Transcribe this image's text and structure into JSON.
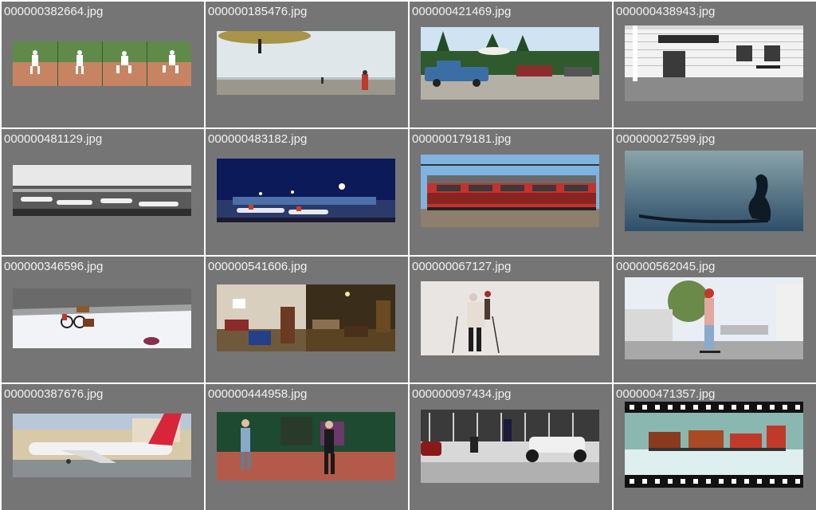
{
  "viewer": {
    "tiles": [
      {
        "filename": "000000382664.jpg",
        "icon": "baseball-pitcher-sequence-image"
      },
      {
        "filename": "000000185476.jpg",
        "icon": "beach-kite-image"
      },
      {
        "filename": "000000421469.jpg",
        "icon": "parked-trucks-image"
      },
      {
        "filename": "000000438943.jpg",
        "icon": "library-building-image"
      },
      {
        "filename": "000000481129.jpg",
        "icon": "airport-planes-bw-image"
      },
      {
        "filename": "000000483182.jpg",
        "icon": "airport-night-image"
      },
      {
        "filename": "000000179181.jpg",
        "icon": "red-train-image"
      },
      {
        "filename": "000000027599.jpg",
        "icon": "surfer-silhouette-image"
      },
      {
        "filename": "000000346596.jpg",
        "icon": "snow-bicycle-image"
      },
      {
        "filename": "000000541606.jpg",
        "icon": "living-room-image"
      },
      {
        "filename": "000000067127.jpg",
        "icon": "skier-image"
      },
      {
        "filename": "000000562045.jpg",
        "icon": "skateboarder-image"
      },
      {
        "filename": "000000387676.jpg",
        "icon": "red-tail-airplane-image"
      },
      {
        "filename": "000000444958.jpg",
        "icon": "kids-tennis-image"
      },
      {
        "filename": "000000097434.jpg",
        "icon": "police-motorcycle-image"
      },
      {
        "filename": "000000471357.jpg",
        "icon": "toy-train-film-image"
      }
    ],
    "colors": {
      "tile_background": "#757575",
      "label_text": "#f2f2f2",
      "grid_gap": "#ffffff"
    }
  }
}
